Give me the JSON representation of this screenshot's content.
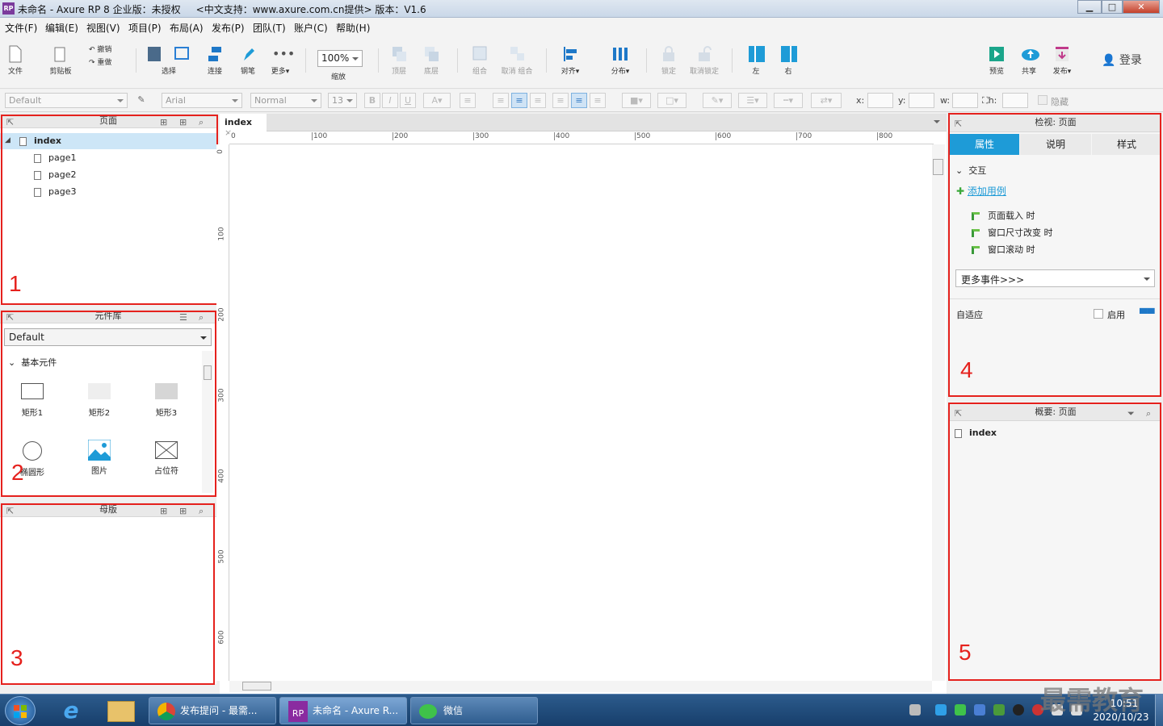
{
  "window": {
    "title": "未命名 - Axure RP 8 企业版：未授权",
    "subtitle": "<中文支持：www.axure.com.cn提供> 版本：V1.6",
    "min": "▁",
    "max": "□",
    "close": "✕"
  },
  "menu": [
    "文件(F)",
    "编辑(E)",
    "视图(V)",
    "项目(P)",
    "布局(A)",
    "发布(P)",
    "团队(T)",
    "账户(C)",
    "帮助(H)"
  ],
  "toolbar": {
    "file": "文件",
    "clipboard": "剪贴板",
    "undo": "撤销",
    "redo": "重做",
    "select": "选择",
    "connect": "连接",
    "pen": "钢笔",
    "more": "更多▾",
    "zoom_value": "100%",
    "zoom": "缩放",
    "top": "顶层",
    "bottom": "底层",
    "group": "组合",
    "ungroup": "取消 组合",
    "align": "对齐▾",
    "distribute": "分布▾",
    "lock": "锁定",
    "unlock": "取消锁定",
    "left": "左",
    "right": "右",
    "preview": "预览",
    "share": "共享",
    "publish": "发布▾",
    "login": "登录"
  },
  "format": {
    "style": "Default",
    "font": "Arial",
    "weight": "Normal",
    "size": "13",
    "x": "x:",
    "y": "y:",
    "w": "w:",
    "h": "h:",
    "hide": "隐藏"
  },
  "pages_panel": {
    "title": "页面",
    "root": "index",
    "children": [
      "page1",
      "page2",
      "page3"
    ],
    "number": "1"
  },
  "library_panel": {
    "title": "元件库",
    "selected": "Default",
    "group": "基本元件",
    "items": [
      "矩形1",
      "矩形2",
      "矩形3",
      "椭圆形",
      "图片",
      "占位符"
    ],
    "number": "2"
  },
  "masters_panel": {
    "title": "母版",
    "number": "3"
  },
  "canvas": {
    "tab": "index",
    "ruler_h": [
      "0",
      "100",
      "200",
      "300",
      "400",
      "500",
      "600",
      "700",
      "800"
    ],
    "ruler_v": [
      "0",
      "100",
      "200",
      "300",
      "400",
      "500",
      "600"
    ]
  },
  "inspector": {
    "title": "检视: 页面",
    "tabs": [
      "属性",
      "说明",
      "样式"
    ],
    "interaction": "交互",
    "add_case": "添加用例",
    "events": [
      "页面载入 时",
      "窗口尺寸改变 时",
      "窗口滚动 时"
    ],
    "more_events": "更多事件>>>",
    "adaptive": "自适应",
    "enable": "启用",
    "number": "4"
  },
  "outline": {
    "title": "概要: 页面",
    "item": "index",
    "number": "5"
  },
  "taskbar": {
    "tasks": [
      "发布提问 - 最需...",
      "未命名 - Axure R...",
      "微信"
    ],
    "time": "10:51",
    "date": "2020/10/23",
    "watermark": "最需教育"
  },
  "colors": {
    "accent": "#1e9bd7",
    "red": "#e5211d"
  }
}
